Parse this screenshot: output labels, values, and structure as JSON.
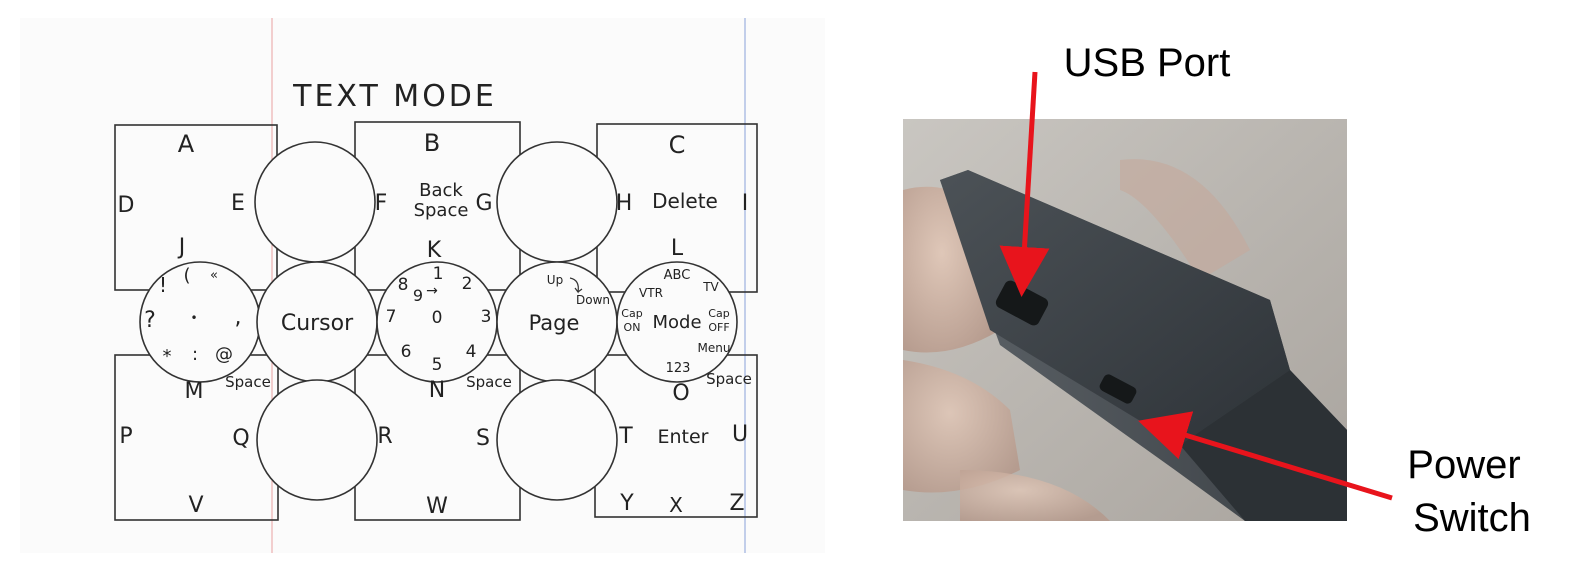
{
  "sketch": {
    "title": "TEXT MODE",
    "squares": [
      {
        "top": "A",
        "left": "D",
        "right": "E",
        "bottom": "J"
      },
      {
        "top": "B",
        "center": [
          "Back",
          "Space"
        ],
        "left": "F",
        "right": "G",
        "bottom": "K"
      },
      {
        "top": "C",
        "center": [
          "Delete"
        ],
        "left": "H",
        "right": "I",
        "bottom": "L"
      },
      {
        "top": "M",
        "left": "P",
        "right": "Q",
        "bottom": "V",
        "corner": "Space"
      },
      {
        "top": "N",
        "left": "R",
        "right": "S",
        "bottom": "W",
        "corner": "Space"
      },
      {
        "top": "O",
        "center": [
          "Enter"
        ],
        "left": "T",
        "right": "U",
        "bottom": [
          "Y",
          "X",
          "Z"
        ],
        "corner": "Space"
      }
    ],
    "circles": {
      "symbols": [
        "!",
        "(",
        "«",
        "?",
        "•",
        ",",
        "*",
        ":",
        "@"
      ],
      "cursor": "Cursor",
      "numbers": [
        "1",
        "2",
        "3",
        "4",
        "5",
        "6",
        "7",
        "8",
        "9",
        "0"
      ],
      "numbers_arrow": "→",
      "page": "Page",
      "page_up": "Up",
      "page_down": "Down",
      "mode": "Mode",
      "mode_labels": {
        "abc": "ABC",
        "tv": "TV",
        "vtr": "VTR",
        "cap_on": [
          "Cap",
          "ON"
        ],
        "cap_off": [
          "Cap",
          "OFF"
        ],
        "menu": "Menu",
        "num": "123"
      }
    }
  },
  "photo": {
    "usb_label": "USB Port",
    "power_label_line1": "Power",
    "power_label_line2": "Switch",
    "arrow_color": "#e8141c"
  }
}
